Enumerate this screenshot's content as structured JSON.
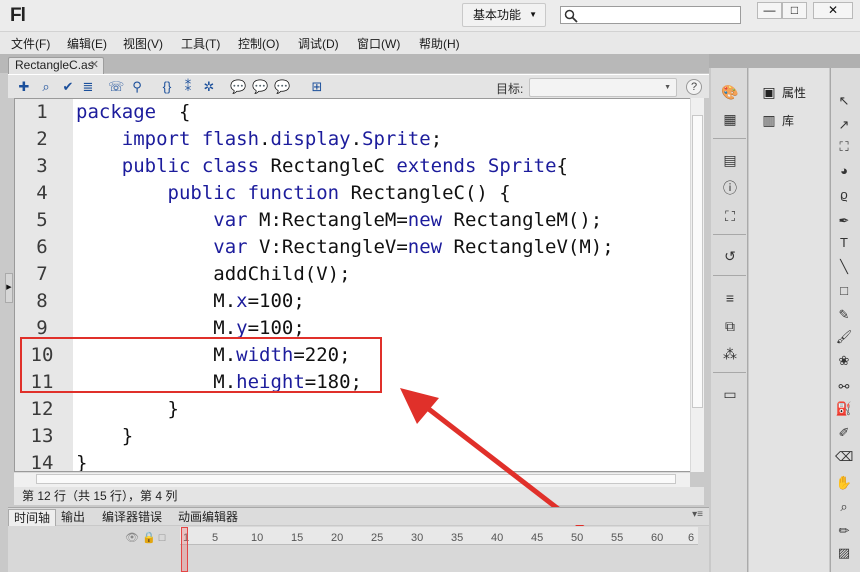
{
  "app": {
    "logo": "Fl",
    "workspace": "基本功能",
    "window_buttons": {
      "min": "—",
      "max": "□",
      "close": "✕"
    }
  },
  "menu": [
    "文件(F)",
    "编辑(E)",
    "视图(V)",
    "工具(T)",
    "控制(O)",
    "调试(D)",
    "窗口(W)",
    "帮助(H)"
  ],
  "document": {
    "tab": "RectangleC.as",
    "close": "✕"
  },
  "code_toolbar": {
    "target_label": "目标:",
    "target_value": "",
    "help": "?"
  },
  "code_lines": [
    {
      "n": "1",
      "text": "package  {"
    },
    {
      "n": "2",
      "text": "    import flash.display.Sprite;"
    },
    {
      "n": "3",
      "text": "    public class RectangleC extends Sprite{"
    },
    {
      "n": "4",
      "text": "        public function RectangleC() {"
    },
    {
      "n": "5",
      "text": "            var M:RectangleM=new RectangleM();"
    },
    {
      "n": "6",
      "text": "            var V:RectangleV=new RectangleV(M);"
    },
    {
      "n": "7",
      "text": "            addChild(V);"
    },
    {
      "n": "8",
      "text": "            M.x=100;"
    },
    {
      "n": "9",
      "text": "            M.y=100;"
    },
    {
      "n": "10",
      "text": "            M.width=220;"
    },
    {
      "n": "11",
      "text": "            M.height=180;"
    },
    {
      "n": "12",
      "text": "        }"
    },
    {
      "n": "13",
      "text": "    }"
    },
    {
      "n": "14",
      "text": "}"
    }
  ],
  "status": "第 12 行（共 15 行），第 4 列",
  "timeline": {
    "tabs": [
      "时间轴",
      "输出",
      "编译器错误",
      "动画编辑器"
    ],
    "ticks": [
      "1",
      "5",
      "10",
      "15",
      "20",
      "25",
      "30",
      "35",
      "40",
      "45",
      "50",
      "55",
      "60",
      "6"
    ]
  },
  "panels": {
    "properties": "属性",
    "library": "库"
  },
  "colors": {
    "keyword": "#1c1c9c",
    "highlight": "#e0302a",
    "arrow": "#e0302a"
  }
}
